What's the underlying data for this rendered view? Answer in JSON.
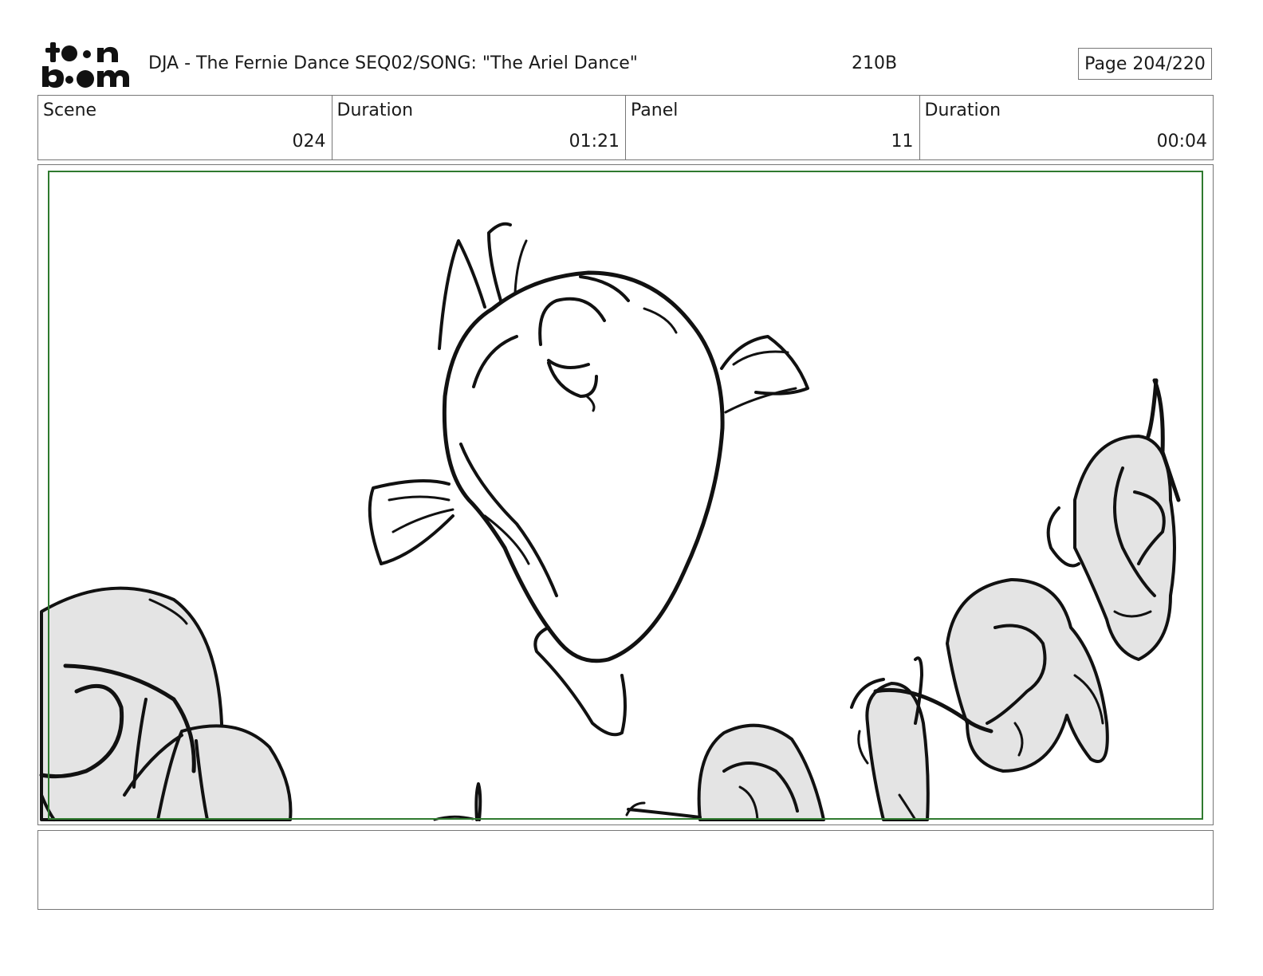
{
  "header": {
    "logo": "toonboom-logo",
    "project_title": "DJA - The Fernie Dance  SEQ02/SONG: \"The Ariel Dance\"",
    "scene_code": "210B",
    "page": "Page 204/220"
  },
  "info": {
    "scene_label": "Scene",
    "scene_value": "024",
    "scene_duration_label": "Duration",
    "scene_duration_value": "01:21",
    "panel_label": "Panel",
    "panel_value": "11",
    "panel_duration_label": "Duration",
    "panel_duration_value": "00:04"
  },
  "colors": {
    "safe_frame": "#2f7a2f",
    "sketch_fill": "#e4e4e4",
    "ink": "#111111"
  },
  "notes": {
    "text": ""
  }
}
